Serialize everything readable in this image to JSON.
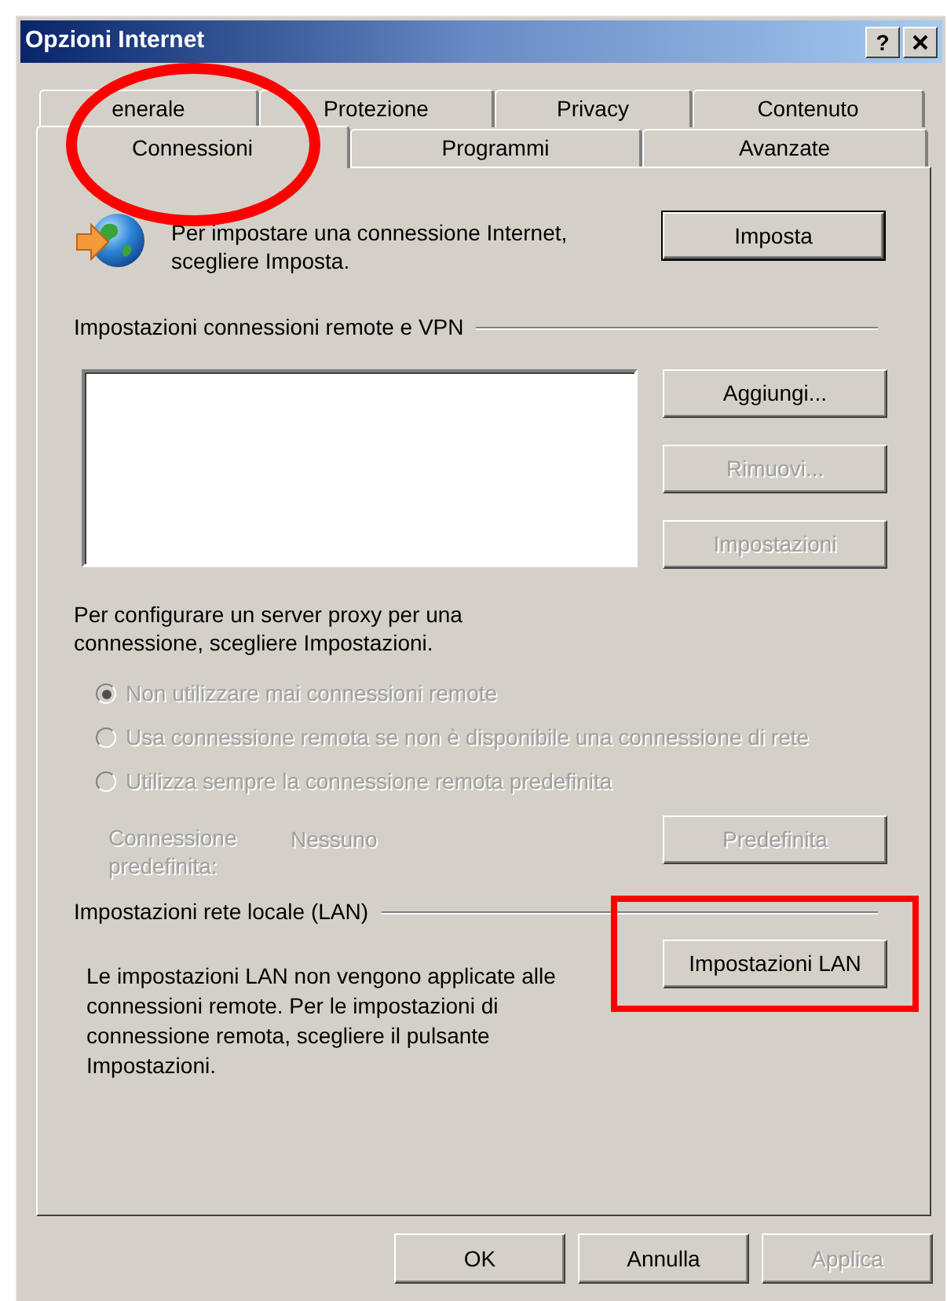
{
  "window": {
    "title": "Opzioni Internet",
    "help_button": "?"
  },
  "tab_rows": [
    [
      {
        "label": "enerale",
        "selected": false
      },
      {
        "label": "Protezione",
        "selected": false
      },
      {
        "label": "Privacy",
        "selected": false
      },
      {
        "label": "Contenuto",
        "selected": false
      }
    ],
    [
      {
        "label": "Connessioni",
        "selected": true
      },
      {
        "label": "Programmi",
        "selected": false
      },
      {
        "label": "Avanzate",
        "selected": false
      }
    ]
  ],
  "setup": {
    "text": "Per impostare una connessione Internet, scegliere Imposta.",
    "button": {
      "label": "Imposta",
      "disabled": false,
      "default": true
    }
  },
  "dialup": {
    "heading": "Impostazioni connessioni remote e VPN",
    "buttons": [
      {
        "label": "Aggiungi...",
        "disabled": false
      },
      {
        "label": "Rimuovi...",
        "disabled": true
      },
      {
        "label": "Impostazioni",
        "disabled": true
      }
    ]
  },
  "proxy_text": "Per configurare un server proxy per una connessione, scegliere Impostazioni.",
  "radios": [
    {
      "label": "Non utilizzare mai connessioni remote",
      "selected": true,
      "disabled": true
    },
    {
      "label": "Usa connessione remota se non è disponibile una connessione di rete",
      "selected": false,
      "disabled": true
    },
    {
      "label": "Utilizza sempre la connessione remota predefinita",
      "selected": false,
      "disabled": true
    }
  ],
  "default_connection": {
    "label": "Connessione predefinita:",
    "value": "Nessuno",
    "disabled": true,
    "button": {
      "label": "Predefinita",
      "disabled": true
    }
  },
  "lan": {
    "heading": "Impostazioni rete locale (LAN)",
    "text": "Le impostazioni LAN non vengono applicate alle connessioni remote. Per le impostazioni di connessione remota, scegliere il pulsante Impostazioni.",
    "button": {
      "label": "Impostazioni LAN",
      "disabled": false
    }
  },
  "footer_buttons": [
    {
      "label": "OK",
      "disabled": false
    },
    {
      "label": "Annulla",
      "disabled": false
    },
    {
      "label": "Applica",
      "disabled": true
    }
  ],
  "annotations": [
    {
      "kind": "ellipse"
    },
    {
      "kind": "rectangle"
    }
  ]
}
